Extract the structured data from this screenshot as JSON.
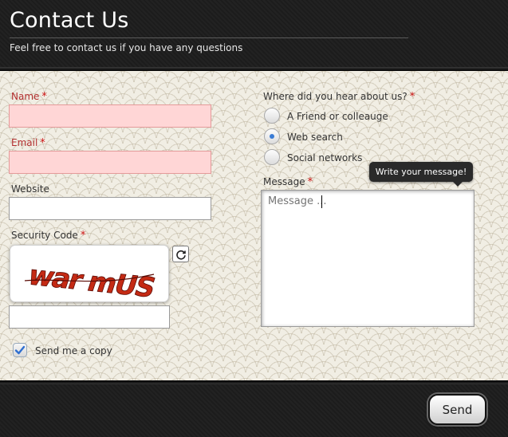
{
  "header": {
    "title": "Contact Us",
    "subtitle": "Feel free to contact us if you have any questions"
  },
  "form": {
    "name": {
      "label": "Name",
      "required_mark": "*",
      "value": ""
    },
    "email": {
      "label": "Email",
      "required_mark": "*",
      "value": ""
    },
    "website": {
      "label": "Website",
      "value": ""
    },
    "security": {
      "label": "Security Code",
      "required_mark": "*",
      "captcha_text": "war mUS",
      "value": ""
    },
    "copy": {
      "label": "Send me a copy",
      "checked": true
    },
    "referral": {
      "label": "Where did you hear about us?",
      "required_mark": "*",
      "options": [
        "A Friend or colleauge",
        "Web search",
        "Social networks"
      ],
      "selected": "Web search"
    },
    "message": {
      "label": "Message",
      "required_mark": "*",
      "placeholder": "Message ...",
      "tooltip": "Write your message!"
    },
    "send_label": "Send"
  },
  "colors": {
    "error_field": "#ffd6d6",
    "required_star": "#cc1111",
    "label_error": "#b33030",
    "radio_selected": "#3a7bd5"
  },
  "icons": {
    "refresh": "refresh-icon",
    "check": "check-icon"
  }
}
